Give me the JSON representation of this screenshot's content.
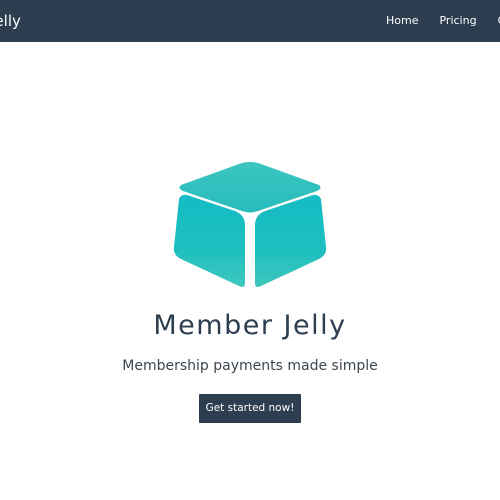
{
  "navbar": {
    "brand": "Jelly",
    "links": [
      "Home",
      "Pricing",
      "Co"
    ]
  },
  "hero": {
    "logo_icon": "jelly-cube-logo",
    "title": "Member Jelly",
    "subtitle": "Membership payments made simple",
    "cta_label": "Get started now!"
  },
  "colors": {
    "navbar_bg": "#2d3e50",
    "accent_teal": "#1fbfbf",
    "button_bg": "#2d3e50"
  }
}
